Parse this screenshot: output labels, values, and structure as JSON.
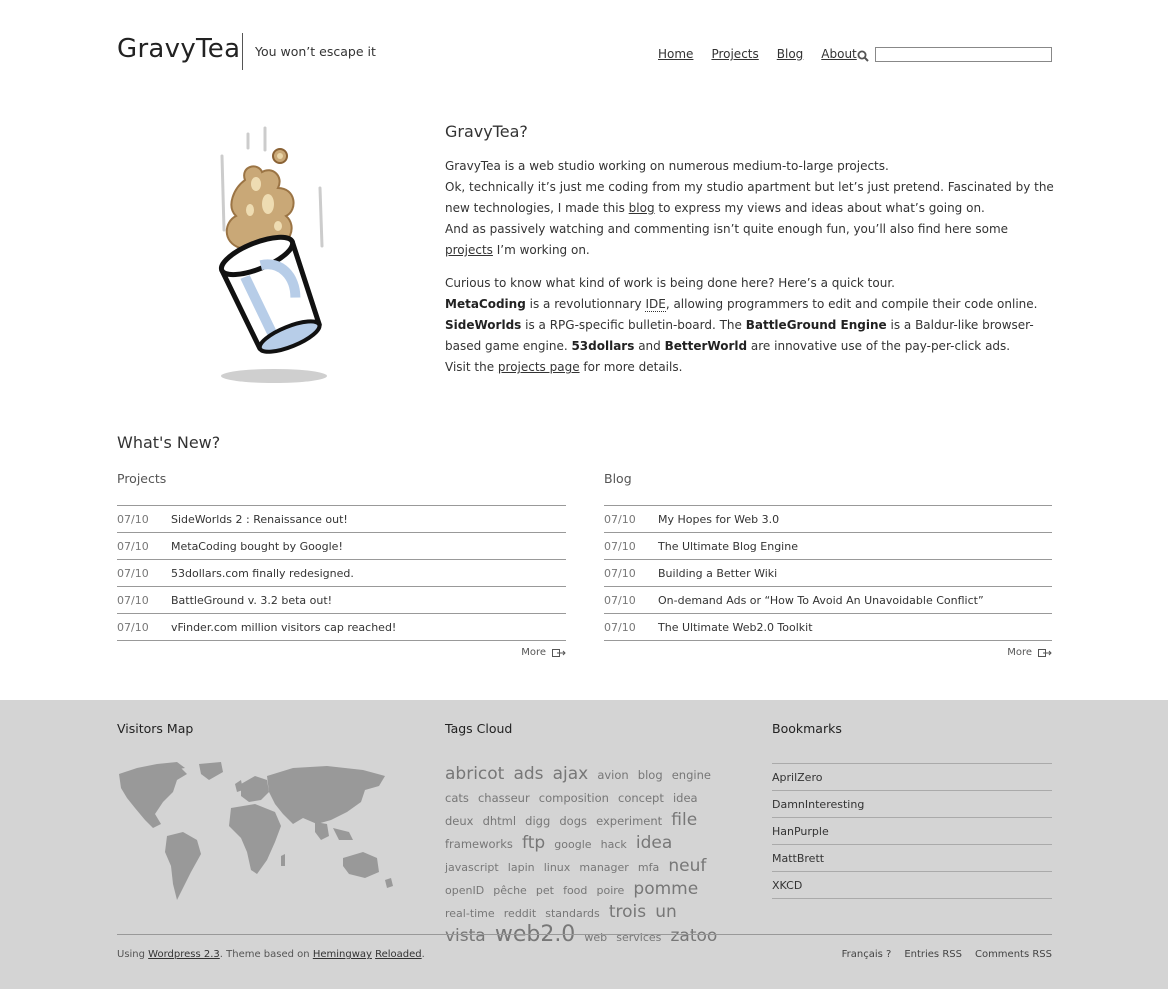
{
  "site": {
    "logo": "GravyTea",
    "tagline": "You won’t escape it"
  },
  "nav": {
    "items": [
      "Home",
      "Projects",
      "Blog",
      "About"
    ],
    "search_placeholder": ""
  },
  "intro": {
    "title": "GravyTea?",
    "p1_a": "GravyTea is a web studio working on numerous medium-to-large projects.",
    "p1_b": "Ok, technically it’s just me coding from my studio apartment but let’s just pretend. Fascinated by the new technologies, I made this ",
    "p1_blog_link": "blog",
    "p1_c": " to express my views and ideas about what’s going on.",
    "p1_d": "And as passively watching and commenting isn’t quite enough fun, you’ll also find here some ",
    "p1_projects_link": "projects",
    "p1_e": " I’m working on.",
    "p2_a": "Curious to know what kind of work is being done here? Here’s a quick tour.",
    "metacoding": "MetaCoding",
    "p2_b": " is a revolutionnary ",
    "ide": "IDE",
    "p2_c": ", allowing programmers to edit and compile their code online.",
    "sideworlds": "SideWorlds",
    "p2_d": " is a RPG-specific bulletin-board. The ",
    "battleground": "BattleGround Engine",
    "p2_e": " is a Baldur-like browser-based game engine. ",
    "fiftythree": "53dollars",
    "p2_f": " and ",
    "betterworld": "BetterWorld",
    "p2_g": " are innovative use of the pay-per-click ads.",
    "p2_h": "Visit the ",
    "projects_page_link": "projects page",
    "p2_i": " for more details."
  },
  "whats_new": {
    "title": "What's New?",
    "projects": {
      "heading": "Projects",
      "items": [
        {
          "date": "07/10",
          "title": "SideWorlds 2 : Renaissance out!"
        },
        {
          "date": "07/10",
          "title": "MetaCoding bought by Google!"
        },
        {
          "date": "07/10",
          "title": "53dollars.com finally redesigned."
        },
        {
          "date": "07/10",
          "title": "BattleGround v. 3.2 beta out!"
        },
        {
          "date": "07/10",
          "title": "vFinder.com million visitors cap reached!"
        }
      ],
      "more": "More"
    },
    "blog": {
      "heading": "Blog",
      "items": [
        {
          "date": "07/10",
          "title": "My Hopes for Web 3.0"
        },
        {
          "date": "07/10",
          "title": "The Ultimate Blog Engine"
        },
        {
          "date": "07/10",
          "title": "Building a Better Wiki"
        },
        {
          "date": "07/10",
          "title": "On-demand Ads or “How To Avoid An Unavoidable Conflict”"
        },
        {
          "date": "07/10",
          "title": "The Ultimate Web2.0 Toolkit"
        }
      ],
      "more": "More"
    }
  },
  "footer": {
    "visitors_map_title": "Visitors Map",
    "tags_title": "Tags Cloud",
    "tags": [
      {
        "t": "abricot",
        "s": 3
      },
      {
        "t": "ads",
        "s": 3
      },
      {
        "t": "ajax",
        "s": 3
      },
      {
        "t": "avion",
        "s": 1
      },
      {
        "t": "blog",
        "s": 1
      },
      {
        "t": "engine",
        "s": 1
      },
      {
        "t": "cats",
        "s": 1
      },
      {
        "t": "chasseur",
        "s": 1
      },
      {
        "t": "composition",
        "s": 1
      },
      {
        "t": "concept",
        "s": 1
      },
      {
        "t": "idea",
        "s": 1
      },
      {
        "t": "deux",
        "s": 1
      },
      {
        "t": "dhtml",
        "s": 1
      },
      {
        "t": "digg",
        "s": 1
      },
      {
        "t": "dogs",
        "s": 1
      },
      {
        "t": "experiment",
        "s": 1
      },
      {
        "t": "file",
        "s": 3
      },
      {
        "t": "frameworks",
        "s": 1
      },
      {
        "t": "ftp",
        "s": 3
      },
      {
        "t": "google",
        "s": 0
      },
      {
        "t": "hack",
        "s": 0
      },
      {
        "t": "idea",
        "s": 3
      },
      {
        "t": "javascript",
        "s": 0
      },
      {
        "t": "lapin",
        "s": 0
      },
      {
        "t": "linux",
        "s": 0
      },
      {
        "t": "manager",
        "s": 0
      },
      {
        "t": "mfa",
        "s": 0
      },
      {
        "t": "neuf",
        "s": 3
      },
      {
        "t": "openID",
        "s": 0
      },
      {
        "t": "pêche",
        "s": 0
      },
      {
        "t": "pet",
        "s": 0
      },
      {
        "t": "food",
        "s": 0
      },
      {
        "t": "poire",
        "s": 0
      },
      {
        "t": "pomme",
        "s": 3
      },
      {
        "t": "real-time",
        "s": 0
      },
      {
        "t": "reddit",
        "s": 0
      },
      {
        "t": "standards",
        "s": 0
      },
      {
        "t": "trois",
        "s": 3
      },
      {
        "t": "un",
        "s": 3
      },
      {
        "t": "vista",
        "s": 3
      },
      {
        "t": "web2.0",
        "s": 4
      },
      {
        "t": "web",
        "s": 0
      },
      {
        "t": "services",
        "s": 0
      },
      {
        "t": "zatoo",
        "s": 3
      }
    ],
    "bookmarks_title": "Bookmarks",
    "bookmarks": [
      "AprilZero",
      "DamnInteresting",
      "HanPurple",
      "MattBrett",
      "XKCD"
    ],
    "credit_using": "Using ",
    "credit_wordpress": "Wordpress 2.3",
    "credit_theme": ". Theme based on ",
    "credit_hemingway": "Hemingway",
    "credit_space": " ",
    "credit_reloaded": "Reloaded",
    "credit_end": ".",
    "links": [
      "Français ?",
      "Entries RSS",
      "Comments RSS"
    ]
  },
  "colors": {
    "footer_bg": "#d4d4d4",
    "map": "#999999",
    "cup_blue": "#b7cde8",
    "tea_brown": "#b08a5a"
  }
}
